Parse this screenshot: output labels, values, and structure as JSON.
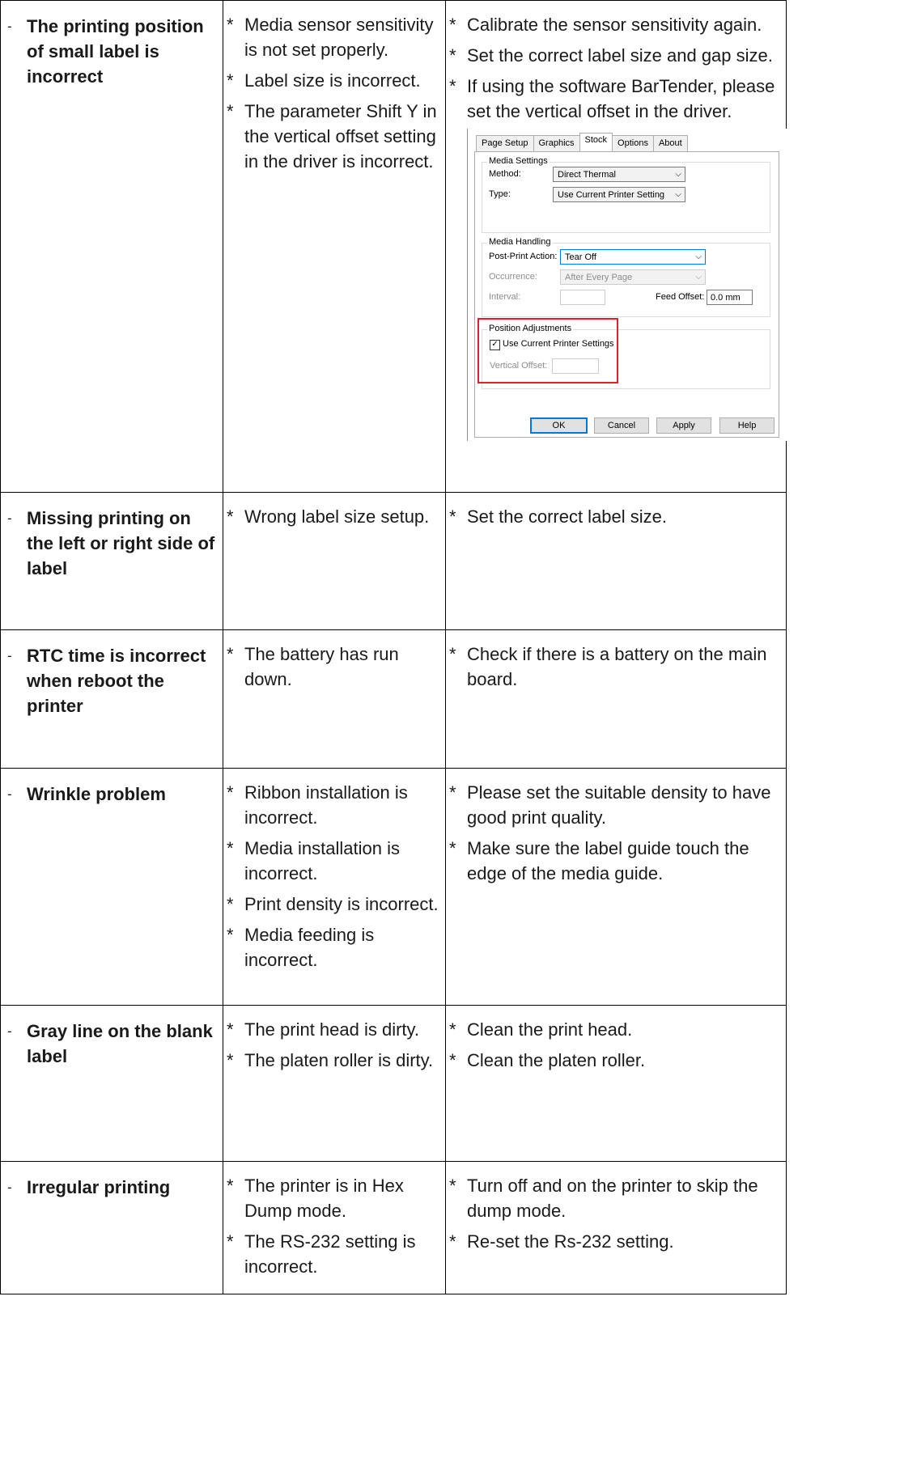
{
  "rows": [
    {
      "problem": "The printing position of small label is incorrect",
      "causes": [
        "Media sensor sensitivity is not set properly.",
        "Label size is incorrect.",
        "The parameter Shift Y in the vertical offset setting in the driver is incorrect."
      ],
      "solutions": [
        "Calibrate the sensor sensitivity again.",
        "Set the correct label size and gap size.",
        "If using the software BarTender, please set the vertical offset in the driver."
      ]
    },
    {
      "problem": "Missing printing on the left or right side of label",
      "causes": [
        "Wrong label size setup."
      ],
      "solutions": [
        "Set the correct label size."
      ]
    },
    {
      "problem": "RTC time is incorrect when reboot the printer",
      "causes": [
        "The battery has run down."
      ],
      "solutions": [
        "Check if there is a battery on the main board."
      ]
    },
    {
      "problem": "Wrinkle problem",
      "causes": [
        "Ribbon installation is incorrect.",
        "Media installation is incorrect.",
        "Print density is incorrect.",
        "Media feeding is incorrect."
      ],
      "solutions": [
        "Please set the suitable density to have good print quality.",
        "Make sure the label guide touch the edge of the media guide."
      ]
    },
    {
      "problem": "Gray line on the blank label",
      "causes": [
        "The print head is dirty.",
        "The platen roller is dirty."
      ],
      "solutions": [
        "Clean the print head.",
        "Clean the platen roller."
      ]
    },
    {
      "problem": "Irregular printing",
      "causes": [
        "The printer is in Hex Dump mode.",
        "The RS-232 setting is incorrect."
      ],
      "solutions": [
        "Turn off and on the printer to skip the dump mode.",
        "Re-set the Rs-232 setting."
      ]
    }
  ],
  "markers": {
    "dash": "-",
    "star": "*"
  },
  "dialog": {
    "tabs": [
      "Page Setup",
      "Graphics",
      "Stock",
      "Options",
      "About"
    ],
    "active_tab": "Stock",
    "media_settings": {
      "title": "Media Settings",
      "method_label": "Method:",
      "method_value": "Direct Thermal",
      "type_label": "Type:",
      "type_value": "Use Current Printer Setting"
    },
    "media_handling": {
      "title": "Media Handling",
      "post_print_label": "Post-Print Action:",
      "post_print_value": "Tear Off",
      "occurrence_label": "Occurrence:",
      "occurrence_value": "After Every Page",
      "interval_label": "Interval:",
      "feed_offset_label": "Feed Offset:",
      "feed_offset_value": "0.0 mm"
    },
    "position_adjustments": {
      "title": "Position Adjustments",
      "use_current_label": "Use Current Printer Settings",
      "vertical_offset_label": "Vertical Offset:"
    },
    "buttons": {
      "ok": "OK",
      "cancel": "Cancel",
      "apply": "Apply",
      "help": "Help"
    },
    "glyphs": {
      "arrow": "⌵",
      "check": "✓"
    }
  }
}
